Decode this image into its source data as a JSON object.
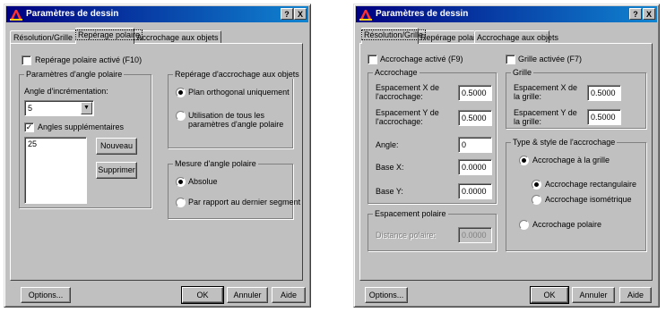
{
  "left": {
    "title": "Paramètres de dessin",
    "help_btn": "?",
    "close_btn": "X",
    "tabs": [
      "Résolution/Grille",
      "Repérage polaire",
      "Accrochage aux objets"
    ],
    "polar_enabled": {
      "label": "Repérage polaire activé (F10)",
      "checked": false
    },
    "angle_group": {
      "title": "Paramètres d'angle polaire",
      "inc_label": "Angle d'incrémentation:",
      "inc_value": "5",
      "extra_label": "Angles supplémentaires",
      "extra_checked": true,
      "list_items": [
        "25"
      ],
      "new_btn": "Nouveau",
      "delete_btn": "Supprimer"
    },
    "snap_group": {
      "title": "Repérage d'accrochage aux objets",
      "opt1": "Plan orthogonal uniquement",
      "opt2": "Utilisation de tous les paramètres d'angle polaire"
    },
    "measure_group": {
      "title": "Mesure d'angle polaire",
      "opt1": "Absolue",
      "opt2": "Par rapport au dernier segment"
    },
    "options_btn": "Options...",
    "ok_btn": "OK",
    "cancel_btn": "Annuler",
    "help_btn_label": "Aide"
  },
  "right": {
    "title": "Paramètres de dessin",
    "help_btn": "?",
    "close_btn": "X",
    "tabs": [
      "Résolution/Grille",
      "Repérage polaire",
      "Accrochage aux objets"
    ],
    "snap_enabled": {
      "label": "Accrochage activé (F9)",
      "checked": false
    },
    "grid_enabled": {
      "label": "Grille activée (F7)",
      "checked": false
    },
    "snap_group": {
      "title": "Accrochage",
      "x_label": "Espacement X de l'accrochage:",
      "x_value": "0.5000",
      "y_label": "Espacement Y de l'accrochage:",
      "y_value": "0.5000",
      "angle_label": "Angle:",
      "angle_value": "0",
      "basex_label": "Base X:",
      "basex_value": "0.0000",
      "basey_label": "Base Y:",
      "basey_value": "0.0000"
    },
    "polar_group": {
      "title": "Espacement polaire",
      "dist_label": "Distance polaire:",
      "dist_value": "0.0000"
    },
    "grid_group": {
      "title": "Grille",
      "x_label": "Espacement X de la grille:",
      "x_value": "0.5000",
      "y_label": "Espacement Y de la grille:",
      "y_value": "0.5000"
    },
    "type_group": {
      "title": "Type & style de l'accrochage",
      "grid_snap": "Accrochage à la grille",
      "rect_snap": "Accrochage rectangulaire",
      "iso_snap": "Accrochage isométrique",
      "polar_snap": "Accrochage polaire"
    },
    "options_btn": "Options...",
    "ok_btn": "OK",
    "cancel_btn": "Annuler",
    "help_btn_label": "Aide"
  }
}
